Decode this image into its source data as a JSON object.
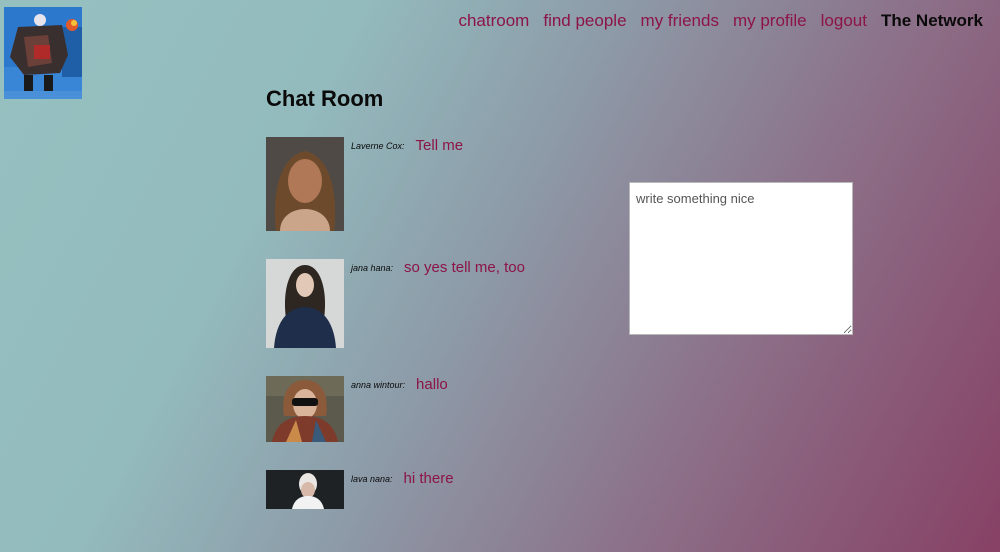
{
  "nav": {
    "items": [
      {
        "label": "chatroom"
      },
      {
        "label": "find people"
      },
      {
        "label": "my friends"
      },
      {
        "label": "my profile"
      },
      {
        "label": "logout"
      }
    ],
    "brand": "The Network"
  },
  "page": {
    "title": "Chat Room"
  },
  "messages": [
    {
      "author": "Laverne Cox:",
      "text": "Tell me"
    },
    {
      "author": "jana hana:",
      "text": "so yes tell me, too"
    },
    {
      "author": "anna wintour:",
      "text": "hallo"
    },
    {
      "author": "lava nana:",
      "text": "hi there"
    }
  ],
  "composer": {
    "placeholder": "write something nice",
    "value": ""
  }
}
